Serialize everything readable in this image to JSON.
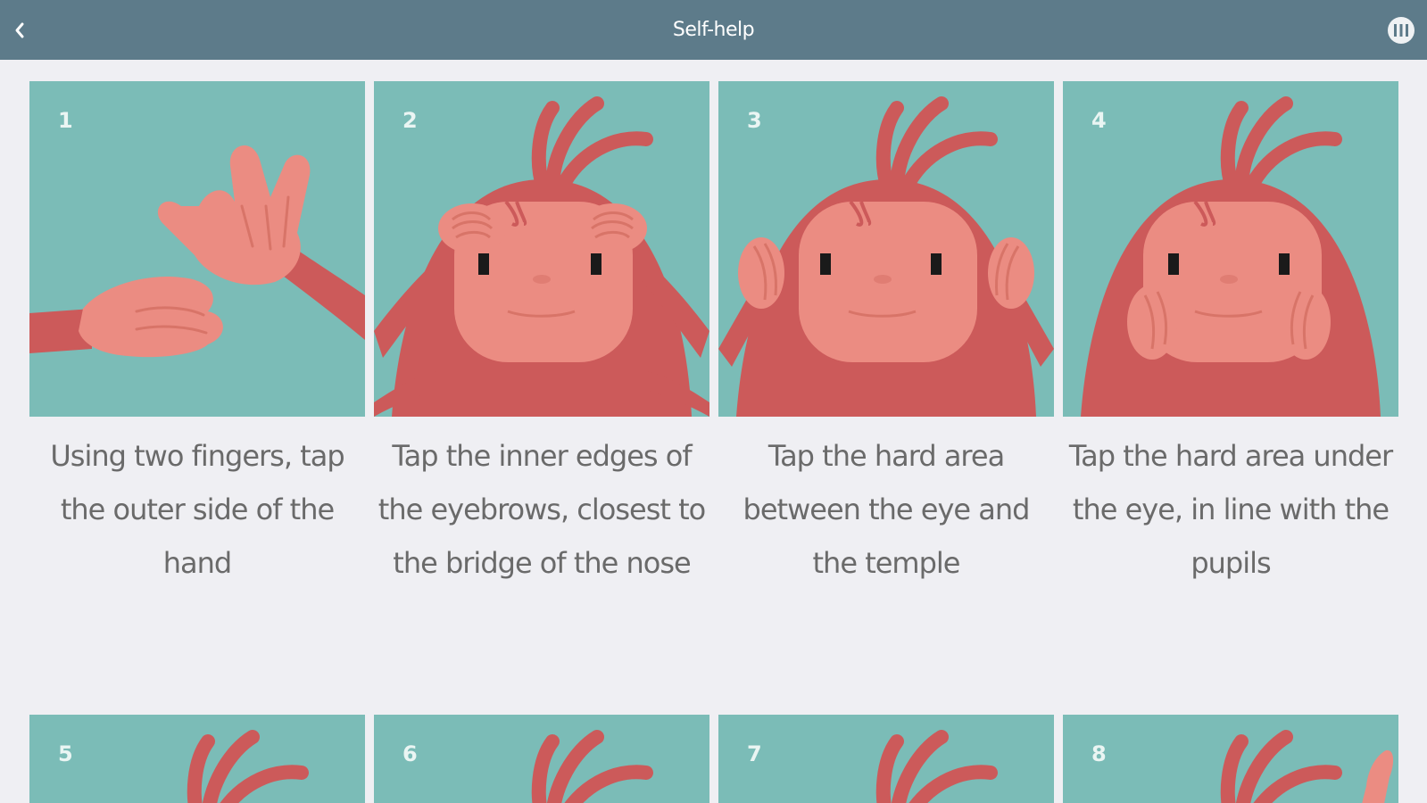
{
  "header": {
    "title": "Self-help",
    "back_icon": "chevron-left-icon",
    "menu_icon": "menu-circle-icon"
  },
  "colors": {
    "header_bg": "#5d7b8a",
    "page_bg": "#efeff3",
    "panel_bg": "#7bbcb7",
    "hair": "#cc5a5a",
    "skin": "#eb8c82"
  },
  "steps": [
    {
      "number": "1",
      "caption": "Using two fingers, tap the outer side of the hand"
    },
    {
      "number": "2",
      "caption": "Tap the inner edges of the eyebrows, closest to the bridge of the nose"
    },
    {
      "number": "3",
      "caption": "Tap the hard area between the eye and the temple"
    },
    {
      "number": "4",
      "caption": "Tap the hard area under the eye, in line with the pupils"
    },
    {
      "number": "5",
      "caption": ""
    },
    {
      "number": "6",
      "caption": ""
    },
    {
      "number": "7",
      "caption": ""
    },
    {
      "number": "8",
      "caption": ""
    }
  ]
}
